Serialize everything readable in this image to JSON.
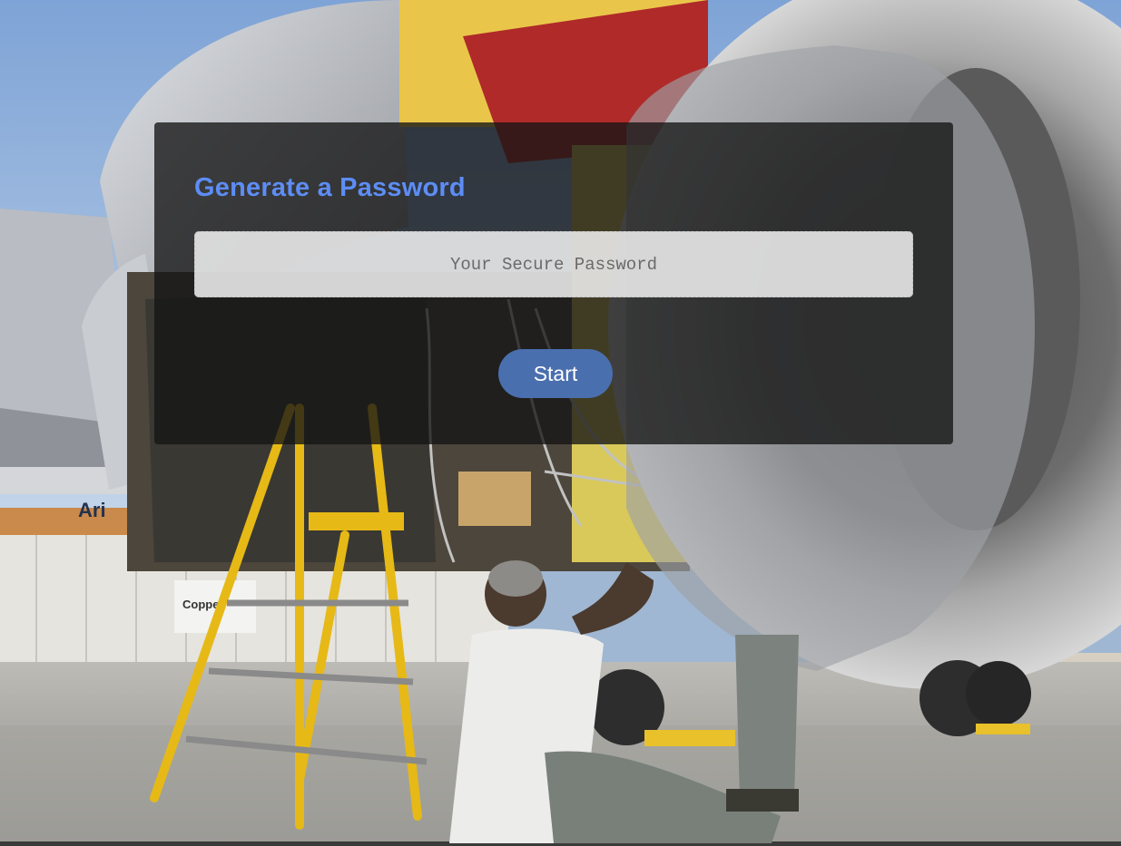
{
  "generator": {
    "title": "Generate a Password",
    "password_placeholder": "Your Secure Password",
    "password_value": "",
    "start_label": "Start"
  },
  "background": {
    "description_icon": "aircraft-engine-photo",
    "sign_text_1": "Coppe",
    "sign_text_2": "Ari"
  },
  "colors": {
    "title": "#5d8df5",
    "button": "#4a6fae",
    "card_overlay": "rgba(20,20,20,0.78)"
  }
}
